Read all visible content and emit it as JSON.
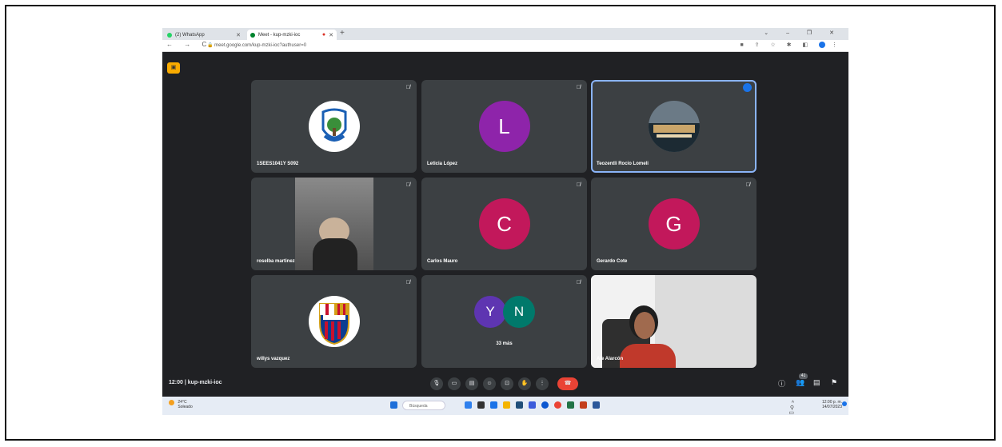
{
  "browser": {
    "tabs": [
      {
        "label": "(2) WhatsApp",
        "icon": "whatsapp-icon"
      },
      {
        "label": "Meet - kup-mzki-ioc",
        "icon": "meet-icon"
      }
    ],
    "url": "meet.google.com/kup-mzki-ioc?authuser=0"
  },
  "participants": [
    {
      "name": "1SEES1041Y S092",
      "type": "image",
      "muted": true
    },
    {
      "name": "Leticia López",
      "initial": "L",
      "color": "#8e24aa",
      "muted": true
    },
    {
      "name": "Teozentli Rocio Lomeli",
      "type": "image",
      "speaking": true
    },
    {
      "name": "roselba martinez",
      "type": "video",
      "muted": true
    },
    {
      "name": "Carlos Mauro",
      "initial": "C",
      "color": "#c2185b",
      "muted": true
    },
    {
      "name": "Gerardo Cote",
      "initial": "G",
      "color": "#c2185b",
      "muted": true
    },
    {
      "name": "willys vazquez",
      "type": "image",
      "muted": true
    },
    {
      "name": "",
      "more": "33 más",
      "initials": [
        "Y",
        "N"
      ],
      "colors": [
        "#5e35b1",
        "#00796b"
      ],
      "muted": true
    },
    {
      "name": "Ale Alarcón",
      "type": "video"
    }
  ],
  "meeting": {
    "time": "12:00",
    "code": "kup-mzki-ioc",
    "participant_count": "41"
  },
  "taskbar": {
    "weather_temp": "24°C",
    "weather_desc": "Soleado",
    "search_placeholder": "Búsqueda",
    "time": "12:00 p. m.",
    "date": "14/07/2023"
  }
}
